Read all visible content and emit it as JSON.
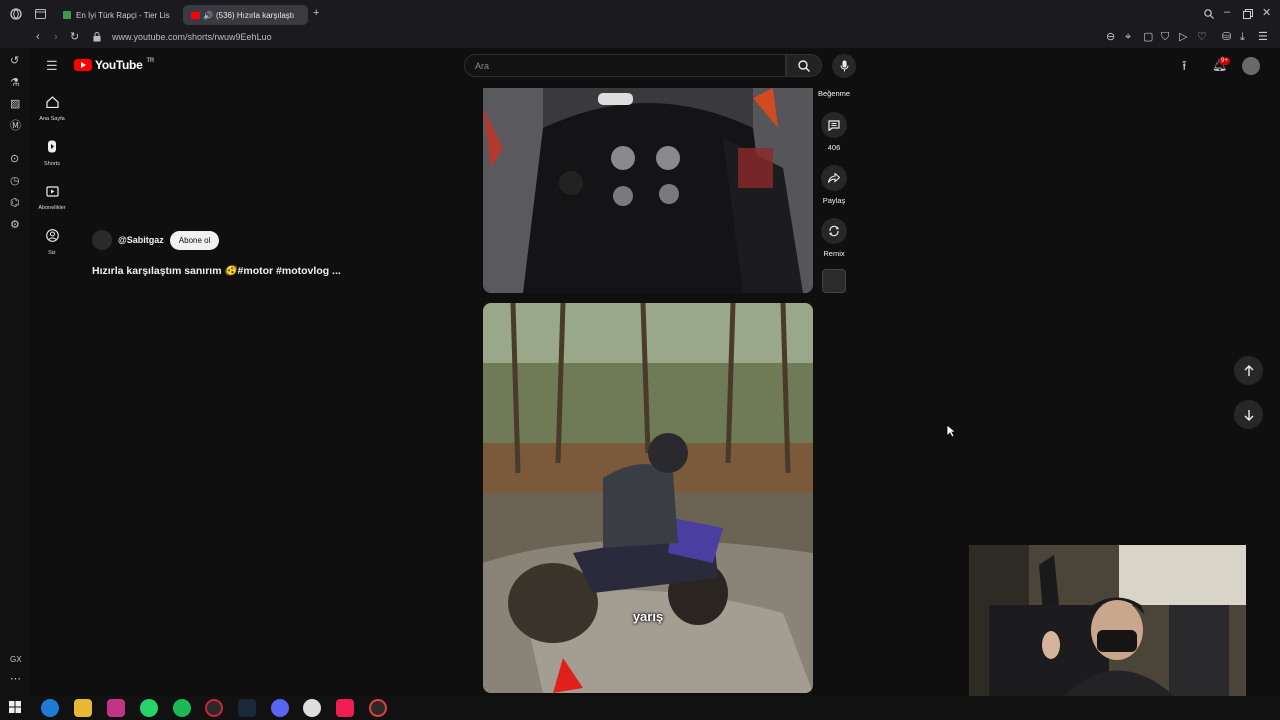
{
  "browser": {
    "tabs": [
      {
        "label": "En İyi Türk Rapçi - Tier Lis",
        "active": false
      },
      {
        "label": "(536) Hızırla karşılaştı",
        "active": true
      }
    ],
    "url": "www.youtube.com/shorts/rwuw9EehLuo"
  },
  "youtube": {
    "logo_text": "YouTube",
    "region": "TR",
    "search_placeholder": "Ara",
    "notification_count": "9+",
    "guide": [
      {
        "label": "Ana Sayfa",
        "icon": "home-icon"
      },
      {
        "label": "Shorts",
        "icon": "shorts-icon"
      },
      {
        "label": "Abonelikler",
        "icon": "subscriptions-icon"
      },
      {
        "label": "Siz",
        "icon": "you-icon"
      }
    ]
  },
  "short": {
    "channel": "@Sabitgaz",
    "subscribe_label": "Abone ol",
    "title": "Hızırla karşılaştım sanırım 🫨#motor #motovlog ...",
    "next_caption": "yarış"
  },
  "actions": {
    "like_label": "Beğenme",
    "comments_count": "406",
    "share_label": "Paylaş",
    "remix_label": "Remix"
  },
  "colors": {
    "background": "#0f0f0f",
    "brand": "#ff0000",
    "surface": "#272727"
  }
}
